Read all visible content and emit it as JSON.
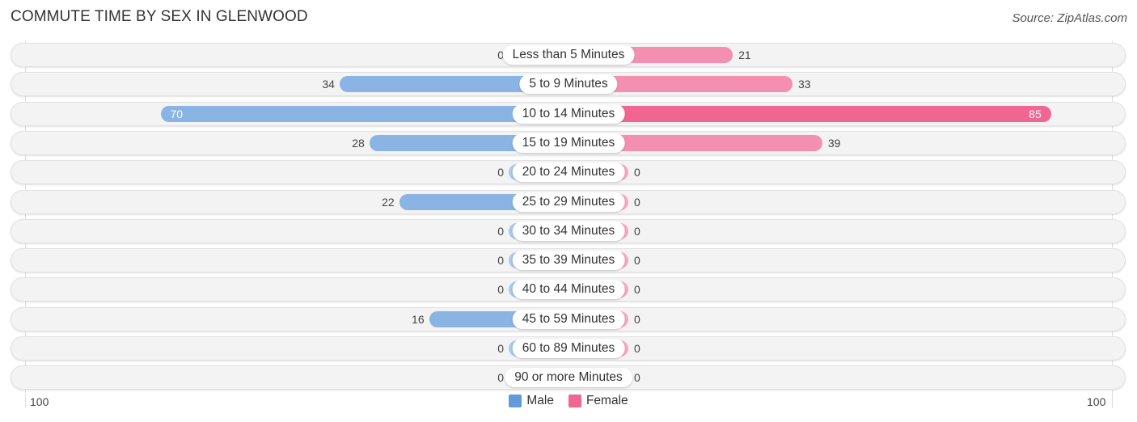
{
  "title": "COMMUTE TIME BY SEX IN GLENWOOD",
  "source": "Source: ZipAtlas.com",
  "colors": {
    "male": "#6499da",
    "female": "#f06690"
  },
  "axis": {
    "left_label": "100",
    "right_label": "100"
  },
  "legend": [
    {
      "label": "Male",
      "color": "#6499da"
    },
    {
      "label": "Female",
      "color": "#f06690"
    }
  ],
  "chart_data": {
    "type": "bar",
    "orientation": "horizontal-diverging",
    "title": "COMMUTE TIME BY SEX IN GLENWOOD",
    "categories": [
      "Less than 5 Minutes",
      "5 to 9 Minutes",
      "10 to 14 Minutes",
      "15 to 19 Minutes",
      "20 to 24 Minutes",
      "25 to 29 Minutes",
      "30 to 34 Minutes",
      "35 to 39 Minutes",
      "40 to 44 Minutes",
      "45 to 59 Minutes",
      "60 to 89 Minutes",
      "90 or more Minutes"
    ],
    "series": [
      {
        "name": "Male",
        "values": [
          0,
          34,
          70,
          28,
          0,
          22,
          0,
          0,
          0,
          16,
          0,
          0
        ]
      },
      {
        "name": "Female",
        "values": [
          21,
          33,
          85,
          39,
          0,
          0,
          0,
          0,
          0,
          0,
          0,
          0
        ]
      }
    ],
    "xlim": [
      -100,
      100
    ],
    "tick_labels": [
      "100",
      "100"
    ],
    "legend_position": "bottom-center",
    "grid": false
  }
}
